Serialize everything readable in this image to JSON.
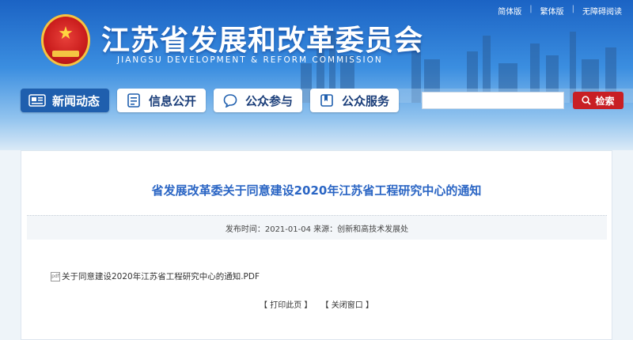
{
  "header": {
    "title_cn": "江苏省发展和改革委员会",
    "title_en": "JIANGSU DEVELOPMENT & REFORM COMMISSION",
    "links": [
      "简体版",
      "繁体版",
      "无障碍阅读"
    ],
    "separator": "|"
  },
  "nav": [
    {
      "label": "新闻动态",
      "icon": "news-icon"
    },
    {
      "label": "信息公开",
      "icon": "document-icon"
    },
    {
      "label": "公众参与",
      "icon": "chat-icon"
    },
    {
      "label": "公众服务",
      "icon": "book-icon"
    }
  ],
  "search": {
    "value": "",
    "placeholder": "",
    "button_label": "检索"
  },
  "article": {
    "title": "省发展改革委关于同意建设2020年江苏省工程研究中心的通知",
    "meta": "发布时间：2021-01-04 来源：创新和高技术发展处",
    "attachment": "关于同意建设2020年江苏省工程研究中心的通知.PDF",
    "print_label": "【 打印此页 】",
    "close_label": "【 关闭窗口 】"
  },
  "colors": {
    "accent": "#1f5fae",
    "title": "#2a65c4",
    "search_button": "#c81f24"
  }
}
